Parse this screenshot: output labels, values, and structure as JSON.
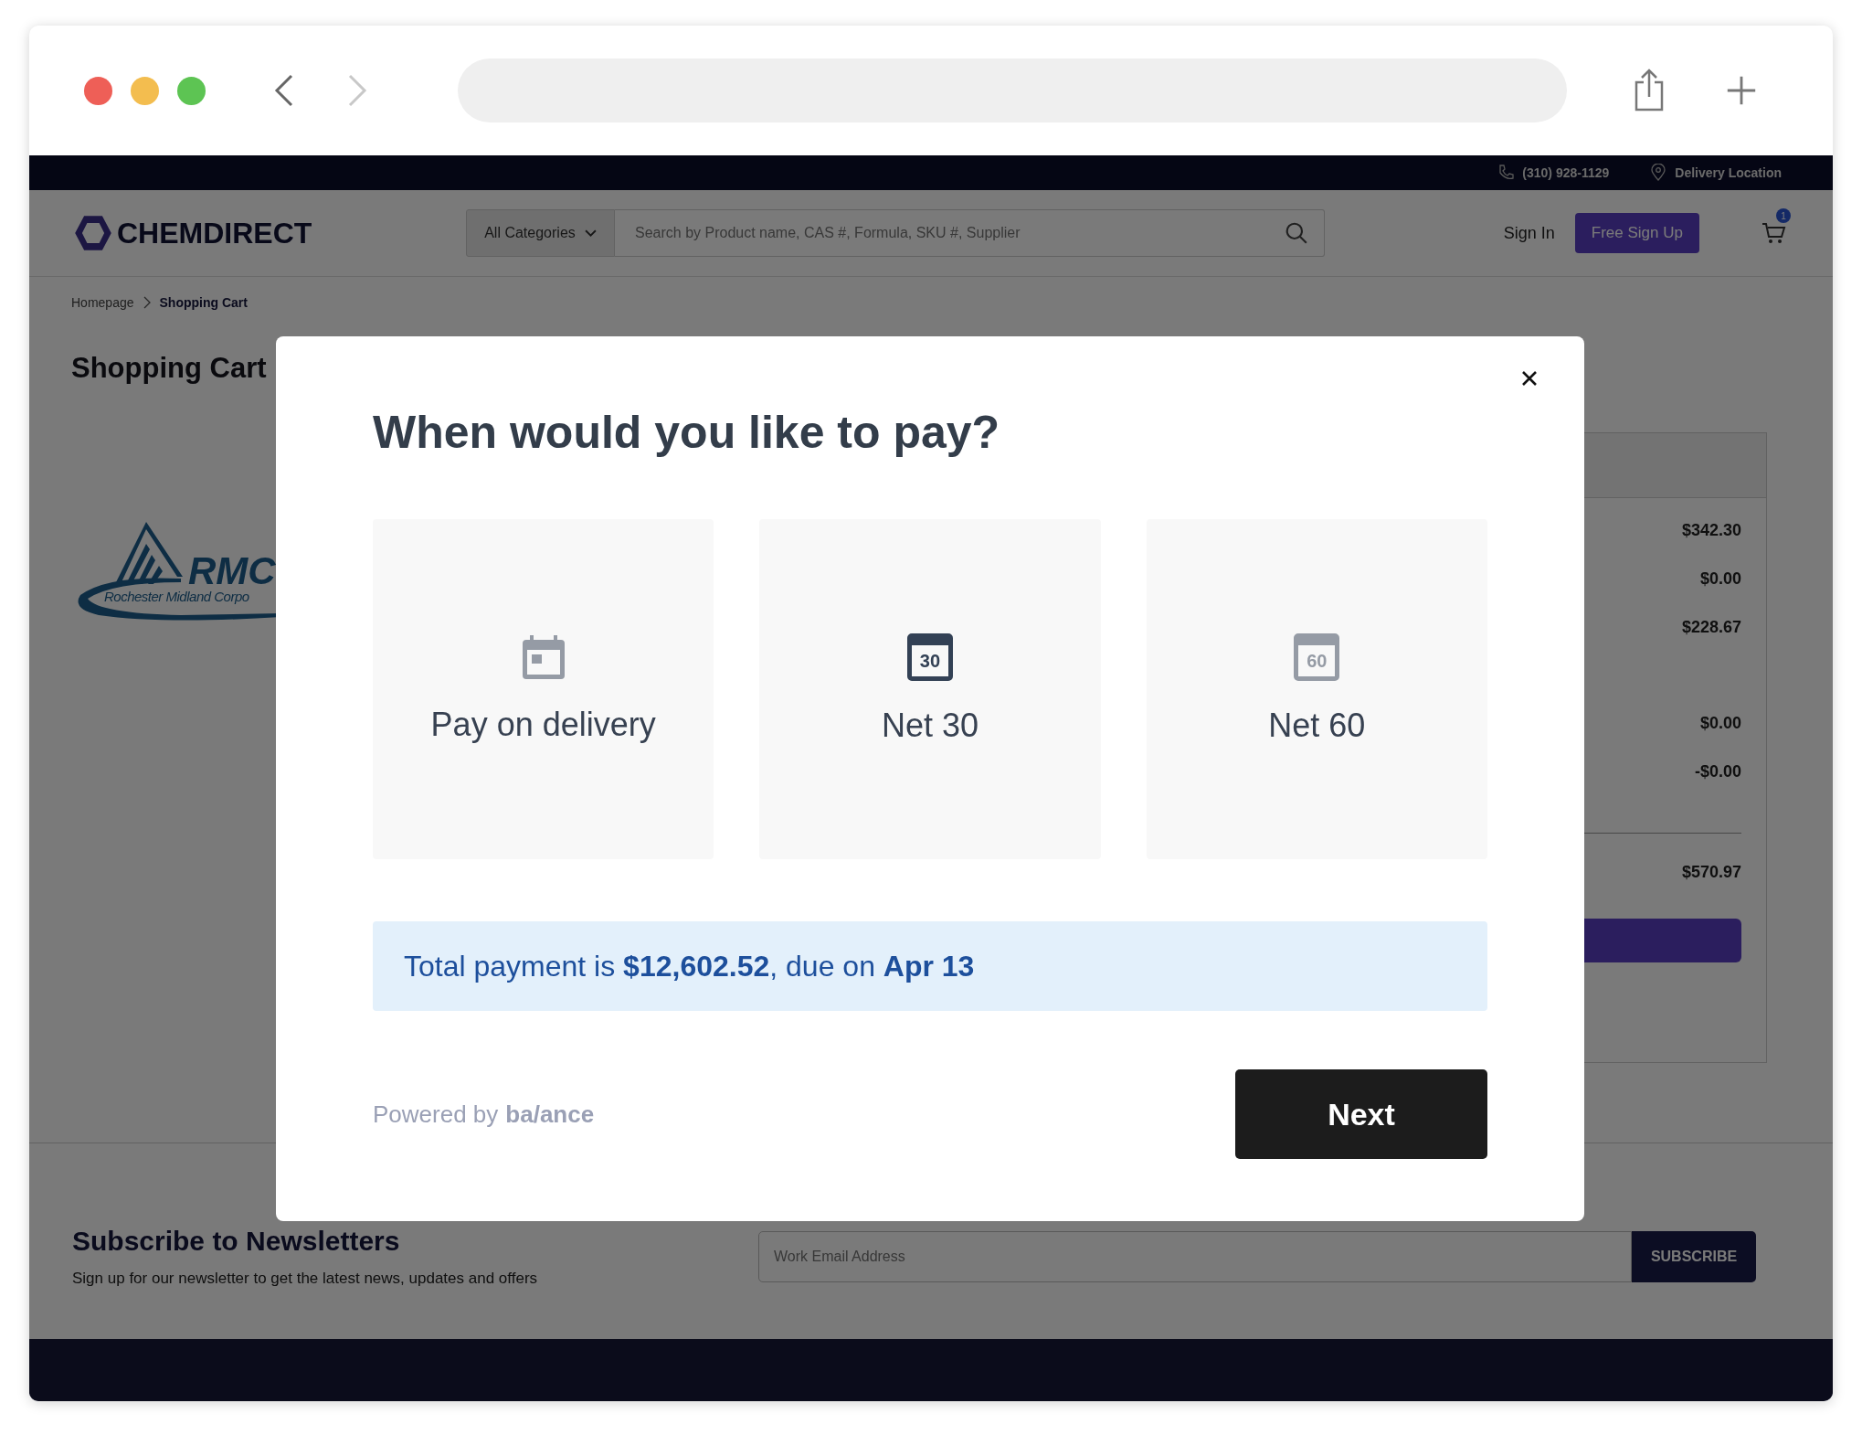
{
  "browser": {
    "nav": [
      {
        "kind": "back",
        "disabled": false
      },
      {
        "kind": "forward",
        "disabled": true
      }
    ]
  },
  "top_bar": {
    "phone": "(310) 928-1129",
    "location": "Delivery Location"
  },
  "header": {
    "logo": "CHEMDIRECT",
    "category": "All Categories",
    "search_placeholder": "Search by Product name, CAS #, Formula, SKU #, Supplier",
    "sign_in": "Sign In",
    "sign_up": "Free Sign Up",
    "cart_count": "1"
  },
  "breadcrumb": [
    {
      "label": "Homepage",
      "current": false
    },
    {
      "label": "Shopping Cart",
      "current": true
    }
  ],
  "page_title": "Shopping Cart",
  "vendor_logo": {
    "initials": "RMC",
    "name": "Rochester Midland Corpo"
  },
  "summary": {
    "values": [
      "$342.30",
      "$0.00",
      "$228.67",
      "$0.00",
      "-$0.00"
    ],
    "total": "$570.97"
  },
  "newsletter": {
    "title": "Subscribe to Newsletters",
    "subtitle": "Sign up for our newsletter to get the latest news, updates and offers",
    "email_placeholder": "Work Email Address",
    "button": "SUBSCRIBE"
  },
  "modal": {
    "title": "When would you like to pay?",
    "options": [
      {
        "kind": "delivery",
        "label": "Pay on delivery",
        "selected": false
      },
      {
        "kind": "net",
        "label": "Net 30",
        "badge": "30",
        "selected": true
      },
      {
        "kind": "net",
        "label": "Net 60",
        "badge": "60",
        "selected": false
      }
    ],
    "summary": "Total payment is **$12,602.52**, due on **Apr 13**",
    "powered_by": "Powered by",
    "brand": "ba/ance",
    "next": "Next"
  }
}
